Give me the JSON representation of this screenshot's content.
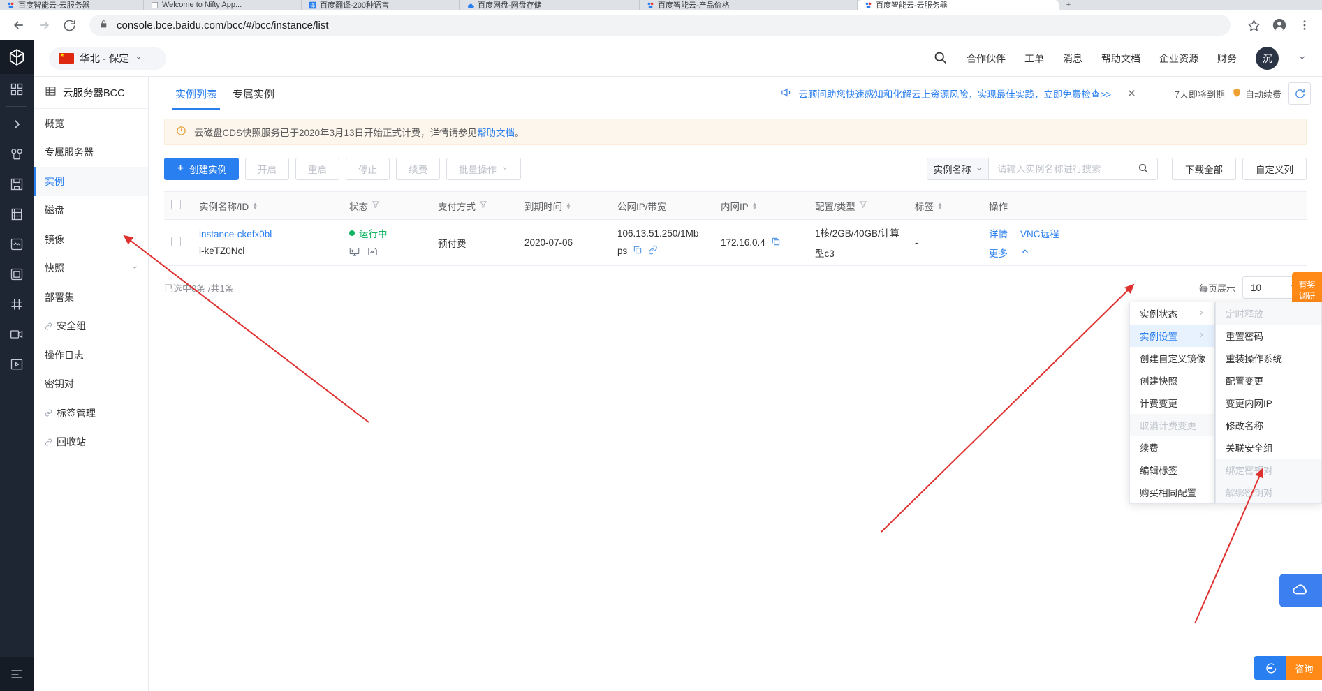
{
  "browser": {
    "tabs": [
      {
        "title": "百度智能云-云服务器",
        "favicon": "baidu-icon",
        "active": false
      },
      {
        "title": "Welcome to Nifty App...",
        "favicon": "page-icon",
        "active": false
      },
      {
        "title": "百度翻译-200种语言",
        "favicon": "translate-icon",
        "active": false
      },
      {
        "title": "百度网盘-网盘存储",
        "favicon": "netdisk-icon",
        "active": false
      },
      {
        "title": "百度智能云-产品价格",
        "favicon": "baidu-icon",
        "active": false
      },
      {
        "title": "百度智能云-云服务器",
        "favicon": "baidu-icon",
        "active": true
      }
    ],
    "new_tab_label": "+",
    "back_icon": "back-arrow-icon",
    "forward_icon": "forward-arrow-icon",
    "reload_icon": "reload-icon",
    "lock_icon": "lock-icon",
    "url": "console.bce.baidu.com/bcc/#/bcc/instance/list",
    "star_icon": "star-icon",
    "profile_icon": "profile-icon",
    "menu_icon": "kebab-menu-icon"
  },
  "rail": {
    "logo": "cube-logo-icon",
    "items": [
      {
        "name": "apps-grid-icon"
      },
      {
        "name": "expand-chevron-icon"
      },
      {
        "name": "network-icon"
      },
      {
        "name": "storage-icon"
      },
      {
        "name": "server-icon"
      },
      {
        "name": "image-icon"
      },
      {
        "name": "monitor-icon"
      },
      {
        "name": "grid-icon"
      },
      {
        "name": "video-icon"
      },
      {
        "name": "media-play-icon"
      }
    ],
    "bottom_item": {
      "name": "list-bottom-icon"
    }
  },
  "topbar": {
    "region": {
      "label": "华北 - 保定",
      "flag": "cn-flag-icon",
      "caret": "chevron-down-icon"
    },
    "search_icon": "search-icon",
    "menus": [
      {
        "label": "合作伙伴"
      },
      {
        "label": "工单"
      },
      {
        "label": "消息"
      },
      {
        "label": "帮助文档"
      },
      {
        "label": "企业资源"
      },
      {
        "label": "财务"
      }
    ],
    "avatar_text": "沉",
    "avatar_caret": "chevron-down-icon"
  },
  "navcol": {
    "title": "云服务器BCC",
    "title_icon": "server-rack-icon",
    "items": [
      {
        "label": "概览",
        "active": false,
        "link": false,
        "chevron": false
      },
      {
        "label": "专属服务器",
        "active": false,
        "link": false,
        "chevron": false
      },
      {
        "label": "实例",
        "active": true,
        "link": false,
        "chevron": false
      },
      {
        "label": "磁盘",
        "active": false,
        "link": false,
        "chevron": false
      },
      {
        "label": "镜像",
        "active": false,
        "link": false,
        "chevron": false
      },
      {
        "label": "快照",
        "active": false,
        "link": false,
        "chevron": true
      },
      {
        "label": "部署集",
        "active": false,
        "link": false,
        "chevron": false
      },
      {
        "label": "安全组",
        "active": false,
        "link": true,
        "chevron": false
      },
      {
        "label": "操作日志",
        "active": false,
        "link": false,
        "chevron": false
      },
      {
        "label": "密钥对",
        "active": false,
        "link": false,
        "chevron": false
      },
      {
        "label": "标签管理",
        "active": false,
        "link": true,
        "chevron": false
      },
      {
        "label": "回收站",
        "active": false,
        "link": true,
        "chevron": false
      }
    ]
  },
  "content": {
    "tabs": [
      {
        "label": "实例列表",
        "active": true
      },
      {
        "label": "专属实例",
        "active": false
      }
    ],
    "promo": {
      "speaker_icon": "megaphone-icon",
      "text": "云顾问助您快速感知和化解云上资源风险，实现最佳实践，立即免费检查>>",
      "close_icon": "close-icon"
    },
    "renew": {
      "expire_text": "7天即将到期",
      "auto_icon": "shield-icon",
      "auto_label": "自动续费",
      "refresh_icon": "refresh-icon"
    },
    "alert": {
      "icon": "warning-circle-icon",
      "text_before": "云磁盘CDS快照服务已于2020年3月13日开始正式计费，详情请参见",
      "link": "帮助文档",
      "text_after": "。"
    },
    "toolbar": {
      "create_label": "创建实例",
      "create_icon": "plus-icon",
      "buttons": [
        {
          "label": "开启",
          "disabled": true
        },
        {
          "label": "重启",
          "disabled": true
        },
        {
          "label": "停止",
          "disabled": true
        },
        {
          "label": "续费",
          "disabled": true
        },
        {
          "label": "批量操作",
          "disabled": true,
          "caret": "chevron-down-icon"
        }
      ],
      "search": {
        "select_label": "实例名称",
        "select_caret": "chevron-down-icon",
        "placeholder": "请输入实例名称进行搜索",
        "value": "",
        "search_icon": "search-icon"
      },
      "download_all": "下载全部",
      "custom_columns": "自定义列"
    },
    "table": {
      "columns": [
        {
          "label": "实例名称/ID",
          "sort": true,
          "filter": false
        },
        {
          "label": "状态",
          "sort": false,
          "filter": true
        },
        {
          "label": "支付方式",
          "sort": false,
          "filter": true
        },
        {
          "label": "到期时间",
          "sort": true,
          "filter": false
        },
        {
          "label": "公网IP/带宽",
          "sort": false,
          "filter": false
        },
        {
          "label": "内网IP",
          "sort": true,
          "filter": false
        },
        {
          "label": "配置/类型",
          "sort": false,
          "filter": true
        },
        {
          "label": "标签",
          "sort": true,
          "filter": false
        },
        {
          "label": "操作",
          "sort": false,
          "filter": false
        }
      ],
      "rows": [
        {
          "checked": false,
          "name": "instance-ckefx0bl",
          "id": "i-keTZ0Ncl",
          "status": "运行中",
          "status_icons": [
            "terminal-icon",
            "monitor-chart-icon"
          ],
          "pay_type": "预付费",
          "expire": "2020-07-06",
          "public_ip": "106.13.51.250/1Mb",
          "public_ip_suffix": "ps",
          "public_ip_icons": [
            "copy-icon",
            "link-icon"
          ],
          "private_ip": "172.16.0.4",
          "private_ip_icon": "copy-icon",
          "spec_line1": "1核/2GB/40GB/计算",
          "spec_line2": "型c3",
          "tag": "-",
          "op_detail": "详情",
          "op_vnc": "VNC远程",
          "op_more": "更多",
          "op_more_caret": "chevron-up-icon"
        }
      ]
    },
    "footer": {
      "selection": "已选中0条 /共1条",
      "page_size_label": "每页展示",
      "page_size_value": "10",
      "page_size_caret": "chevron-down-icon"
    },
    "more_menu": {
      "left": [
        {
          "label": "实例状态",
          "submenu": true,
          "state": "normal"
        },
        {
          "label": "实例设置",
          "submenu": true,
          "state": "active"
        },
        {
          "label": "创建自定义镜像",
          "submenu": false,
          "state": "normal"
        },
        {
          "label": "创建快照",
          "submenu": false,
          "state": "normal"
        },
        {
          "label": "计费变更",
          "submenu": false,
          "state": "normal"
        },
        {
          "label": "取消计费变更",
          "submenu": false,
          "state": "disabled"
        },
        {
          "label": "续费",
          "submenu": false,
          "state": "normal"
        },
        {
          "label": "编辑标签",
          "submenu": false,
          "state": "normal"
        },
        {
          "label": "购买相同配置",
          "submenu": false,
          "state": "normal"
        }
      ],
      "right": [
        {
          "label": "定时释放",
          "state": "disabled"
        },
        {
          "label": "重置密码",
          "state": "normal"
        },
        {
          "label": "重装操作系统",
          "state": "normal"
        },
        {
          "label": "配置变更",
          "state": "normal"
        },
        {
          "label": "变更内网IP",
          "state": "normal"
        },
        {
          "label": "修改名称",
          "state": "normal"
        },
        {
          "label": "关联安全组",
          "state": "normal"
        },
        {
          "label": "绑定密钥对",
          "state": "disabled"
        },
        {
          "label": "解绑密钥对",
          "state": "disabled"
        }
      ]
    }
  },
  "widgets": {
    "orange_tab": "有奖\n调研",
    "blue_tab_icon": "cloud-service-icon",
    "bottom_left_icon": "chat-icon",
    "bottom_right_label": "咨询"
  },
  "colors": {
    "accent": "#2a7ff0",
    "success": "#13b565",
    "warning": "#e6a23c",
    "orange": "#ff8a18",
    "rail_bg": "#1f2633",
    "annotation": "#e03131"
  }
}
